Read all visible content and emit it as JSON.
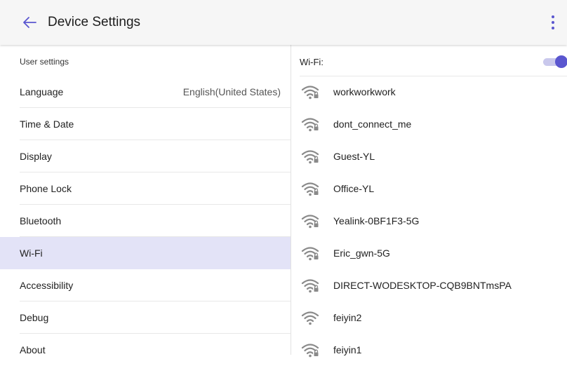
{
  "header": {
    "title": "Device Settings",
    "back_icon": "arrow-left-icon",
    "menu_icon": "more-vertical-icon",
    "accent_color": "#5a56cf"
  },
  "settings": {
    "section_title": "User settings",
    "items": [
      {
        "label": "Language",
        "value": "English(United States)"
      },
      {
        "label": "Time & Date",
        "value": ""
      },
      {
        "label": "Display",
        "value": ""
      },
      {
        "label": "Phone Lock",
        "value": ""
      },
      {
        "label": "Bluetooth",
        "value": ""
      },
      {
        "label": "Wi-Fi",
        "value": "",
        "selected": true
      },
      {
        "label": "Accessibility",
        "value": ""
      },
      {
        "label": "Debug",
        "value": ""
      },
      {
        "label": "About",
        "value": ""
      }
    ]
  },
  "wifi": {
    "label": "Wi-Fi:",
    "enabled": true,
    "networks": [
      {
        "ssid": "workworkwork",
        "secured": true
      },
      {
        "ssid": "dont_connect_me",
        "secured": true
      },
      {
        "ssid": "Guest-YL",
        "secured": true
      },
      {
        "ssid": "Office-YL",
        "secured": true
      },
      {
        "ssid": "Yealink-0BF1F3-5G",
        "secured": true
      },
      {
        "ssid": "Eric_gwn-5G",
        "secured": true
      },
      {
        "ssid": "DIRECT-WODESKTOP-CQB9BNTmsPA",
        "secured": true
      },
      {
        "ssid": "feiyin2",
        "secured": false
      },
      {
        "ssid": "feiyin1",
        "secured": true
      }
    ]
  }
}
